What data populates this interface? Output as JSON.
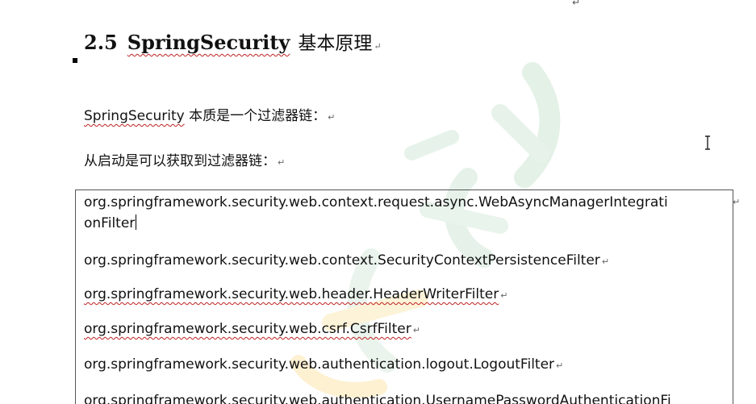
{
  "heading": {
    "number": "2.5",
    "product": "SpringSecurity",
    "title": "基本原理"
  },
  "paragraphs": {
    "p1_product": "SpringSecurity",
    "p1_text": " 本质是一个过滤器链：",
    "p2_text": "从启动是可以获取到过滤器链："
  },
  "filters": {
    "line0a": "org.springframework.security.web.context.request.async.WebAsyncManagerIntegrati",
    "line0b": "onFilter",
    "line1": "org.springframework.security.web.context.SecurityContextPersistenceFilter",
    "line2": "org.springframework.security.web.header.HeaderWriterFilter",
    "line3": "org.springframework.security.web.csrf.CsrfFilter",
    "line4": "org.springframework.security.web.authentication.logout.LogoutFilter",
    "line5": "org.springframework.security.web.authentication.UsernamePasswordAuthenticationFi"
  },
  "marks": {
    "paragraph": "↵"
  },
  "colors": {
    "text": "#111111",
    "spellcheck": "#c02020",
    "watermark": "#e7f2ea"
  },
  "icons": {
    "cursor": "text-cursor-icon",
    "watermark": "watermark-logo-icon"
  }
}
